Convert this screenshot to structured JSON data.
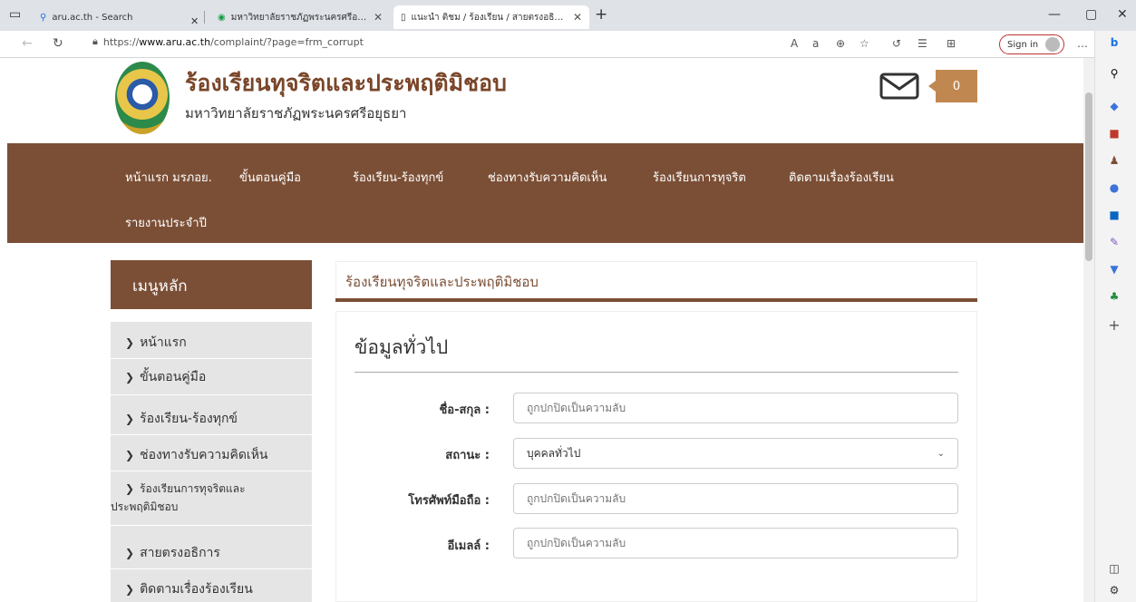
{
  "browser": {
    "tabs": [
      {
        "label": "aru.ac.th - Search"
      },
      {
        "label": "มหาวิทยาลัยราชภัฏพระนครศรีอยุธยา"
      },
      {
        "label": "แนะนำ ติชม / ร้องเรียน / สายตรงอธิการ"
      }
    ],
    "url_prefix": "https://",
    "url_domain": "www.aru.ac.th",
    "url_path": "/complaint/?page=frm_corrupt",
    "sign_in_label": "Sign in"
  },
  "header": {
    "title": "ร้องเรียนทุจริตและประพฤติมิชอบ",
    "subtitle": "มหาวิทยาลัยราชภัฏพระนครศรีอยุธยา",
    "mail_count": "0"
  },
  "nav": {
    "items": [
      {
        "label": "หน้าแรก มรภอย."
      },
      {
        "label": "ขั้นตอนคู่มือ"
      },
      {
        "label": "ร้องเรียน-ร้องทุกข์"
      },
      {
        "label": "ช่องทางรับความคิดเห็น"
      },
      {
        "label": "ร้องเรียนการทุจริต"
      },
      {
        "label": "ติดตามเรื่องร้องเรียน"
      },
      {
        "label": "รายงานประจำปี"
      }
    ]
  },
  "sidebar": {
    "heading": "เมนูหลัก",
    "items": [
      {
        "label": "หน้าแรก"
      },
      {
        "label": "ขั้นตอนคู่มือ"
      },
      {
        "label": "ร้องเรียน-ร้องทุกข์"
      },
      {
        "label": "ช่องทางรับความคิดเห็น"
      },
      {
        "label": "ร้องเรียนการทุจริตและ",
        "label2": "ประพฤติมิชอบ"
      },
      {
        "label": "สายตรงอธิการ"
      },
      {
        "label": "ติดตามเรื่องร้องเรียน"
      }
    ]
  },
  "content": {
    "panel_title": "ร้องเรียนทุจริตและประพฤติมิชอบ",
    "section_title": "ข้อมูลทั่วไป",
    "fields": {
      "name_label": "ชื่อ-สกุล :",
      "name_placeholder": "ถูกปกปิดเป็นความลับ",
      "status_label": "สถานะ :",
      "status_value": "บุคคลทั่วไป",
      "phone_label": "โทรศัพท์มือถือ :",
      "phone_placeholder": "ถูกปกปิดเป็นความลับ",
      "email_label": "อีเมลล์ :",
      "email_placeholder": "ถูกปกปิดเป็นความลับ"
    }
  },
  "colors": {
    "brand_brown": "#7b4f36",
    "badge_tan": "#c08850",
    "title_brown": "#7a4629"
  }
}
